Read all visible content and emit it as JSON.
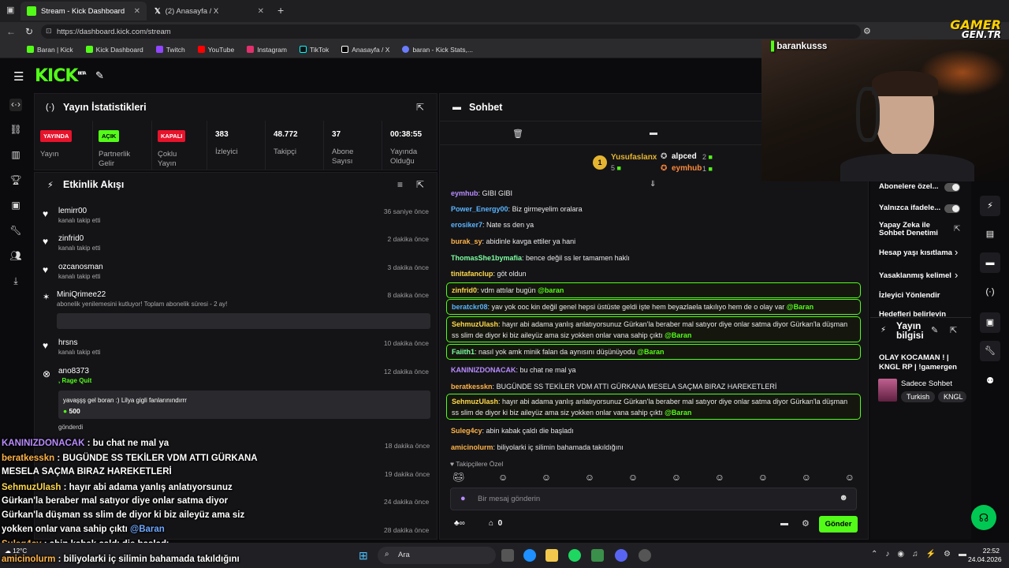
{
  "browser": {
    "tabs": [
      {
        "label": "Stream - Kick Dashboard",
        "active": true
      },
      {
        "label": "(2) Anasayfa / X",
        "active": false
      }
    ],
    "url": "https://dashboard.kick.com/stream",
    "bookmarks": [
      "Baran | Kick",
      "Kick Dashboard",
      "Twitch",
      "YouTube",
      "Instagram",
      "TikTok",
      "Anasayfa / X",
      "baran - Kick Stats,..."
    ]
  },
  "brand": {
    "logo": "KICK",
    "beta": "BETA",
    "watermark_top": "GAMER",
    "watermark_bottom": "GEN.TR"
  },
  "stats": {
    "title": "Yayın İstatistikleri",
    "items": [
      {
        "badge": "YAYINDA",
        "badge_color": "#e8132b",
        "label": "Yayın"
      },
      {
        "badge": "AÇIK",
        "badge_color": "#53fc18",
        "label": "Partnerlik Gelir"
      },
      {
        "badge": "KAPALI",
        "badge_color": "#e8132b",
        "label": "Çoklu Yayın"
      },
      {
        "value": "383",
        "label": "İzleyici"
      },
      {
        "value": "48.772",
        "label": "Takipçi"
      },
      {
        "value": "37",
        "label": "Abone Sayısı"
      },
      {
        "value": "00:38:55",
        "label": "Yayında Olduğu"
      }
    ]
  },
  "activity": {
    "title": "Etkinlik Akışı",
    "items": [
      {
        "name": "lemirr00",
        "sub": "kanalı takip etti",
        "time": "36 saniye önce"
      },
      {
        "name": "zinfrid0",
        "sub": "kanalı takip etti",
        "time": "2 dakika önce"
      },
      {
        "name": "ozcanosman",
        "sub": "kanalı takip etti",
        "time": "3 dakika önce"
      },
      {
        "name": "MiniQrimee22",
        "sub": "abonelik yenilemesini kutluyor! Toplam abonelik süresi - 2 ay!",
        "time": "8 dakika önce"
      },
      {
        "name": "hrsns",
        "sub": "kanalı takip etti",
        "time": "10 dakika önce"
      },
      {
        "name": "ano8373",
        "sub": ", Rage Quit",
        "time": "12 dakika önce"
      }
    ],
    "gift_message": "yavaşşş gel boran :) Lilya gigli fanlarınındırrr",
    "gift_amount": "500",
    "gift_sent": "gönderdi",
    "hidden_times": [
      "18 dakika önce",
      "19 dakika önce",
      "24 dakika önce",
      "28 dakika önce"
    ]
  },
  "chat": {
    "title": "Sohbet",
    "leaderboard": [
      {
        "name": "Yusufaslanx",
        "count": "5",
        "rank": "1"
      },
      {
        "name": "alpced",
        "count": "2"
      },
      {
        "name": "eymhub",
        "count": "1"
      }
    ],
    "messages": [
      {
        "user": "eymhub",
        "color": "#b98cff",
        "text": "GIBI GIBI",
        "hl": false
      },
      {
        "user": "Power_Energy00",
        "color": "#5ab4ff",
        "text": "Biz girmeyelim oralara",
        "hl": false
      },
      {
        "user": "erosiker7",
        "color": "#5ab4ff",
        "text": "Nate ss den ya",
        "hl": false
      },
      {
        "user": "burak_sy",
        "color": "#ffb347",
        "text": "abidinle kavga ettiler ya hani",
        "hl": false
      },
      {
        "user": "ThomasShe1bymafia",
        "color": "#7dffa0",
        "text": "bence değil ss ler tamamen haklı",
        "hl": false
      },
      {
        "user": "tinitafanclup",
        "color": "#ffd84d",
        "text": "göt oldun",
        "hl": false
      },
      {
        "user": "zinfrid0",
        "color": "#ffd84d",
        "text": "vdm attılar bugün",
        "mention": "@baran",
        "hl": true
      },
      {
        "user": "beratckr08",
        "color": "#5ab4ff",
        "text": "yav yok ooc kin değil genel hepsi üstüste geldi işte hem beyazlaela takılıyo hem de o olay var",
        "mention": "@Baran",
        "hl": true
      },
      {
        "user": "SehmuzUlash",
        "color": "#ffd84d",
        "text": "hayır abi adama yanlış anlatıyorsunuz Gürkan'la beraber mal satıyor diye onlar satma diyor Gürkan'la düşman ss slim de diyor ki biz aileyüz ama siz yokken onlar vana sahip çıktı",
        "mention": "@Baran",
        "hl": true
      },
      {
        "user": "Faiith1",
        "color": "#7dffa0",
        "text": "nasıl yok amk minik falan da aynısını düşünüyodu",
        "mention": "@Baran",
        "hl": true
      },
      {
        "user": "KANINIZDONACAK",
        "color": "#b98cff",
        "text": "bu chat ne mal ya",
        "hl": false
      },
      {
        "user": "beratkesskn",
        "color": "#ffb347",
        "text": "BUGÜNDE SS TEKİLER VDM ATTI GÜRKANA MESELA SAÇMA BIRAZ HAREKETLERİ",
        "hl": false
      },
      {
        "user": "SehmuzUlash",
        "color": "#ffd84d",
        "text": "hayır abi adama yanlış anlatıyorsunuz Gürkan'la beraber mal satıyor diye onlar satma diyor Gürkan'la düşman ss slim de diyor ki biz aileyüz ama siz yokken onlar vana sahip çıktı",
        "mention": "@Baran",
        "hl": true
      },
      {
        "user": "Suleg4cy",
        "color": "#ffb347",
        "text": "abin kabak çaldı die başladı",
        "hl": false
      },
      {
        "user": "amicinolurm",
        "color": "#ffb347",
        "text": "biliyolarki iç silimin bahamada takıldığını",
        "hl": false
      }
    ],
    "followers_label": "Takipçilere Özel",
    "input_placeholder": "Bir mesaj gönderin",
    "points": "0",
    "send_label": "Gönder"
  },
  "settings": {
    "items": [
      "Abonelere özel...",
      "Yalnızca ifadele...",
      "Yapay Zeka ile Sohbet Denetimi",
      "Hesap yaşı kısıtlama",
      "Yasaklanmış kelimel",
      "İzleyici Yönlendir",
      "Hedefleri belirleyin"
    ],
    "stream_info_title": "Yayın bilgisi",
    "stream_title": "OLAY KOCAMAN ! | KNGL RP | !gamergen",
    "category": "Sadece Sohbet",
    "tags": [
      "Turkish",
      "KNGL"
    ]
  },
  "webcam": {
    "username": "barankusss"
  },
  "overlay": [
    {
      "user": "KANINIZDONACAK",
      "text": "bu chat ne mal ya",
      "color": "#b98cff"
    },
    {
      "user": "beratkesskn",
      "text": "BUGÜNDE SS TEKİLER VDM ATTI GÜRKANA",
      "color": "#ffb347"
    },
    {
      "user": "",
      "text": "MESELA SAÇMA BIRAZ HAREKETLERİ",
      "color": "#fff"
    },
    {
      "user": "SehmuzUlash",
      "text": "hayır abi adama yanlış anlatıyorsunuz",
      "color": "#ffd84d"
    },
    {
      "user": "",
      "text": "Gürkan'la beraber mal satıyor diye onlar satma diyor",
      "color": "#fff"
    },
    {
      "user": "",
      "text": "Gürkan'la düşman ss slim de diyor ki biz aileyüz ama siz",
      "color": "#fff"
    },
    {
      "user": "",
      "text": "yokken onlar vana sahip çıktı",
      "mention": "@Baran",
      "color": "#fff"
    },
    {
      "user": "Suleg4cy",
      "text": "abin kabak çaldı die başladı",
      "color": "#ffb347"
    },
    {
      "user": "amicinolurm",
      "text": "biliyolarki iç silimin bahamada takıldığını",
      "color": "#ffb347"
    }
  ],
  "taskbar": {
    "search": "Ara",
    "weather": "12°C",
    "time": "22:52",
    "date": "24.04.2026"
  }
}
